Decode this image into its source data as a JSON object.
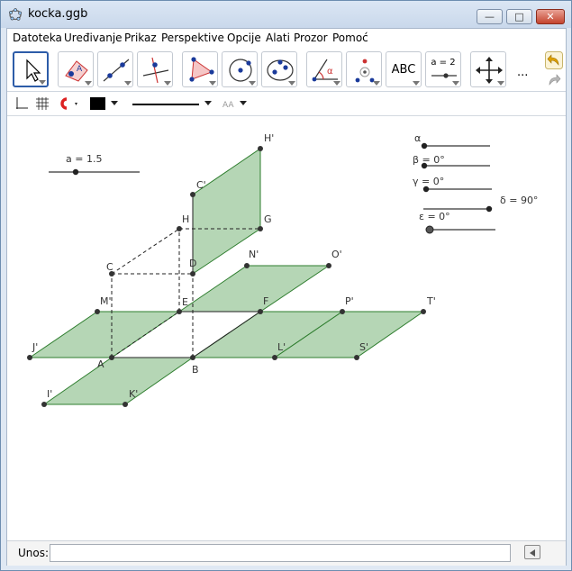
{
  "window": {
    "title": "kocka.ggb"
  },
  "menu": [
    "Datoteka",
    "Uređivanje",
    "Prikaz",
    "Perspektive",
    "Opcije",
    "Alati",
    "Prozor",
    "Pomoć"
  ],
  "toolbar": {
    "text_tool_label": "ABC",
    "slider_tool_label": "a = 2",
    "more_label": "..."
  },
  "graphics": {
    "slider_a": "a = 1.5",
    "angle_alpha": "α",
    "angle_beta": "β = 0°",
    "angle_gamma": "γ = 0°",
    "angle_delta": "δ = 90°",
    "angle_epsilon": "ε = 0°",
    "points": {
      "A": "A",
      "B": "B",
      "C": "C",
      "D": "D",
      "E": "E",
      "F": "F",
      "G": "G",
      "H": "H",
      "C1": "C'",
      "H1": "H'",
      "N1": "N'",
      "O1": "O'",
      "M1": "M'",
      "P1": "P'",
      "T1": "T'",
      "J1": "J'",
      "L1": "L'",
      "S1": "S'",
      "I1": "I'",
      "K1": "K'"
    }
  },
  "inputbar": {
    "label": "Unos:",
    "value": ""
  },
  "colors": {
    "face_fill": "#a8cfa8",
    "face_stroke": "#2e7d2e",
    "point": "#333333"
  }
}
